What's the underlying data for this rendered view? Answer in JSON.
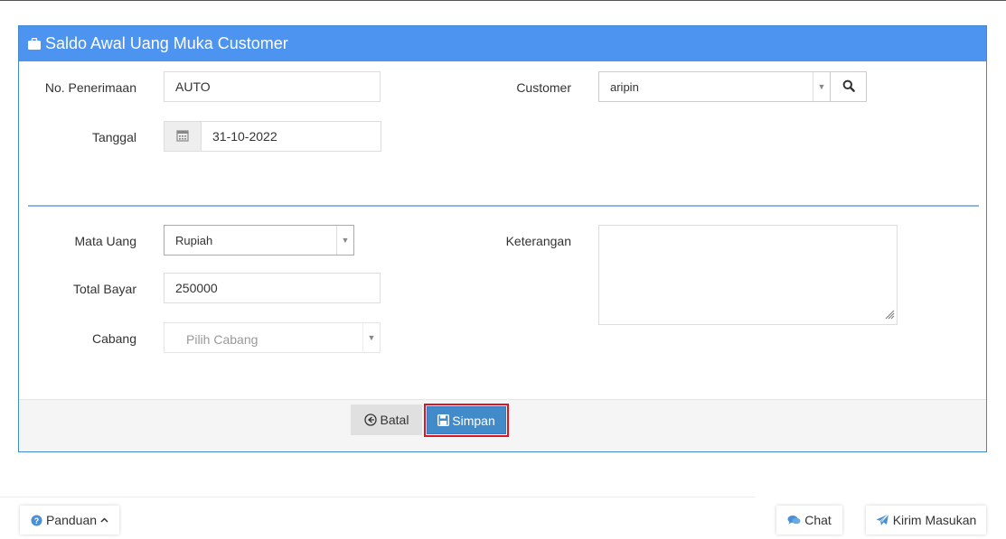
{
  "panel": {
    "title": "Saldo Awal Uang Muka Customer",
    "title_icon": "briefcase-icon",
    "header_color": "#4d94f0"
  },
  "form": {
    "no_penerimaan": {
      "label": "No. Penerimaan",
      "value": "AUTO"
    },
    "tanggal": {
      "label": "Tanggal",
      "value": "31-10-2022",
      "icon": "calendar-icon"
    },
    "customer": {
      "label": "Customer",
      "value": "aripin",
      "search_icon": "search-icon"
    },
    "mata_uang": {
      "label": "Mata Uang",
      "value": "Rupiah"
    },
    "total_bayar": {
      "label": "Total Bayar",
      "value": "250000"
    },
    "cabang": {
      "label": "Cabang",
      "placeholder": "Pilih Cabang"
    },
    "keterangan": {
      "label": "Keterangan",
      "value": ""
    }
  },
  "footer": {
    "batal_label": "Batal",
    "simpan_label": "Simpan",
    "highlight_color": "#e0141e"
  },
  "bottom": {
    "panduan_label": "Panduan",
    "chat_label": "Chat",
    "kirim_label": "Kirim Masukan"
  }
}
